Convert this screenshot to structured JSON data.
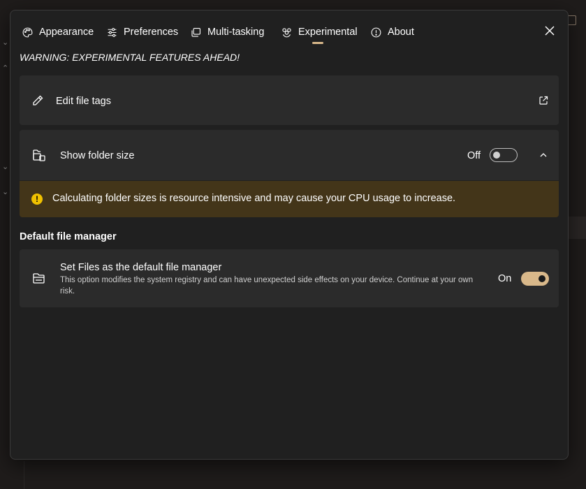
{
  "tabs": [
    {
      "label": "Appearance",
      "icon": "palette-icon"
    },
    {
      "label": "Preferences",
      "icon": "sliders-icon"
    },
    {
      "label": "Multi-tasking",
      "icon": "windows-icon"
    },
    {
      "label": "Experimental",
      "icon": "flask-icon",
      "selected": true
    },
    {
      "label": "About",
      "icon": "info-icon"
    }
  ],
  "warning": "WARNING: EXPERIMENTAL FEATURES AHEAD!",
  "edit_tags": {
    "label": "Edit file tags"
  },
  "folder_size": {
    "label": "Show folder size",
    "state": "Off",
    "info": "Calculating folder sizes is resource intensive and may cause your CPU usage to increase."
  },
  "default_manager": {
    "section_title": "Default file manager",
    "label": "Set Files as the default file manager",
    "description": "This option modifies the system registry and can have unexpected side effects on your device. Continue at your own risk.",
    "state": "On"
  },
  "colors": {
    "accent": "#d9b88a",
    "dialog_bg": "#202020",
    "card_bg": "#2b2b2b",
    "warning_bg": "#433519",
    "warning_icon": "#f0c100"
  }
}
